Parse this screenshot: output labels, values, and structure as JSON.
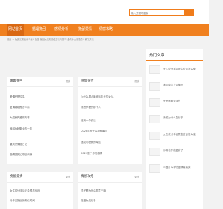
{
  "search": {
    "placeholder": "输入关键词搜索"
  },
  "nav": {
    "items": [
      {
        "label": "网站首页",
        "active": true
      },
      {
        "label": "婚姻挽回",
        "active": false
      },
      {
        "label": "感情分析",
        "active": false
      },
      {
        "label": "挽留爱情",
        "active": false
      },
      {
        "label": "情感攻略",
        "active": false
      }
    ]
  },
  "breadcrumb": "首页 > 女朋友提出分手怎么挽回 挽回女友的最佳方法与技巧 爱情十大问题怎么解决方法",
  "panels": [
    {
      "title": "婚姻挽回",
      "more": "更多",
      "items": [
        "爱情不是交易",
        "爱情婚姻是否中缘",
        "大四丢失爱情故事",
        "我和大龄剩女的一年",
        "重庆的情感日记",
        "做情感的心理咨询师"
      ]
    },
    {
      "title": "感情分析",
      "more": "更多",
      "items": [
        "为什么男人最难追年长的女人",
        "感恩节里的那个人",
        "还有一个说法",
        "2023年有什么新鲜事儿",
        "遇见你是我的幸运",
        "2022属于你的感情"
      ]
    },
    {
      "title": "挽留爱情",
      "more": "更多",
      "items": [
        "女生说分手后还会想念你吗",
        "分手后挽回的最佳时间"
      ]
    },
    {
      "title": "情感攻略",
      "more": "更多",
      "items": [
        "男子看为什么愿意干嘛",
        "狂爱女友分手"
      ]
    }
  ],
  "sidebar": {
    "title": "热门文章",
    "items": [
      "女生说分手后男生应该怎么做",
      "满意单位之后挽回",
      "爱是需要坚持的",
      "我们为什么会分手",
      "女生说分手后男生应该怎么做",
      "你再也不能爱我了",
      "中国什么样的爱情最真实"
    ]
  }
}
